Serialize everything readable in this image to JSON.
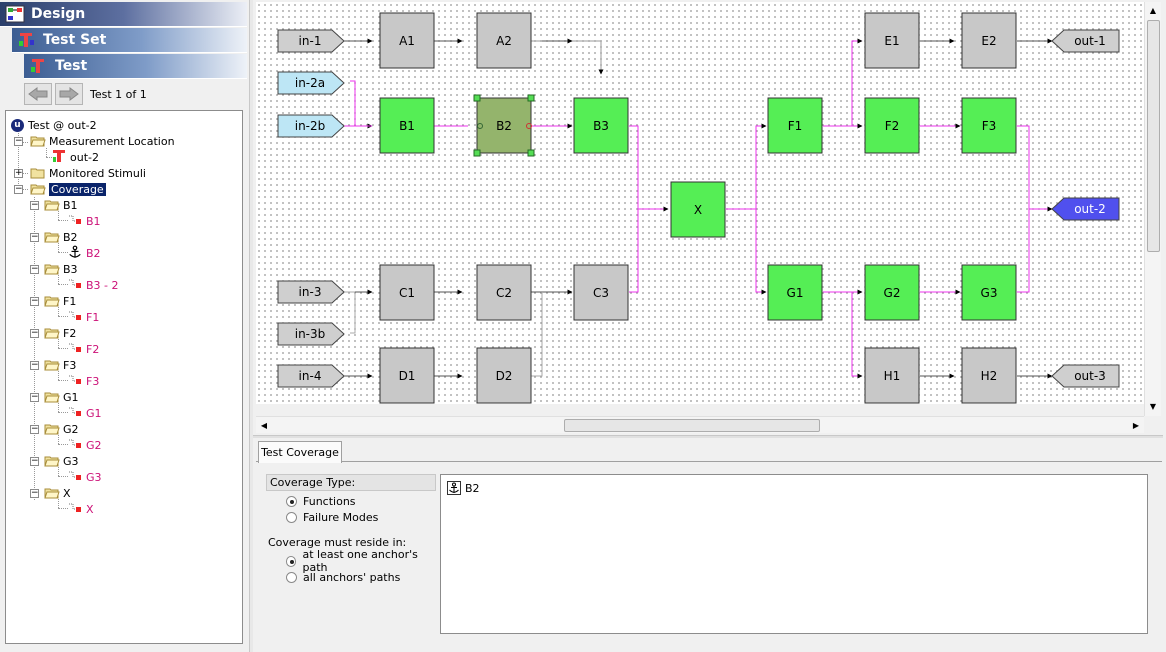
{
  "left": {
    "design_label": "Design",
    "testset_label": "Test Set",
    "test_label": "Test",
    "nav_label": "Test 1 of 1",
    "tree": {
      "root": "Test @ out-2",
      "measurement": "Measurement Location",
      "measurement_child": "out-2",
      "monitored": "Monitored Stimuli",
      "coverage": "Coverage",
      "folders": [
        {
          "name": "B1",
          "child": "B1"
        },
        {
          "name": "B2",
          "child": "B2"
        },
        {
          "name": "B3",
          "child": "B3 - 2"
        },
        {
          "name": "F1",
          "child": "F1"
        },
        {
          "name": "F2",
          "child": "F2"
        },
        {
          "name": "F3",
          "child": "F3"
        },
        {
          "name": "G1",
          "child": "G1"
        },
        {
          "name": "G2",
          "child": "G2"
        },
        {
          "name": "G3",
          "child": "G3"
        },
        {
          "name": "X",
          "child": "X"
        }
      ]
    }
  },
  "diagram": {
    "inputs": [
      "in-1",
      "in-2a",
      "in-2b",
      "in-3",
      "in-3b",
      "in-4"
    ],
    "outputs": [
      "out-1",
      "out-2",
      "out-3"
    ],
    "gray_blocks": [
      "A1",
      "A2",
      "C1",
      "C2",
      "C3",
      "D1",
      "D2",
      "E1",
      "E2",
      "H1",
      "H2"
    ],
    "green_blocks": [
      "B1",
      "B3",
      "X",
      "F1",
      "F2",
      "F3",
      "G1",
      "G2",
      "G3"
    ],
    "selected_block": "B2",
    "colors": {
      "gray": "#c8c8c8",
      "green": "#55ee55",
      "selected": "#94b46c",
      "magenta": "#ee33ee",
      "in_light": "#bde6f5",
      "out_active": "#5050ee"
    }
  },
  "bottom": {
    "tab_label": "Test Coverage",
    "coverage_type_label": "Coverage Type:",
    "opt_functions": "Functions",
    "opt_failure": "Failure Modes",
    "reside_label": "Coverage must reside in:",
    "opt_anchor_one": "at least one anchor's path",
    "opt_anchor_all": "all anchors' paths",
    "coverage_item": "B2"
  }
}
